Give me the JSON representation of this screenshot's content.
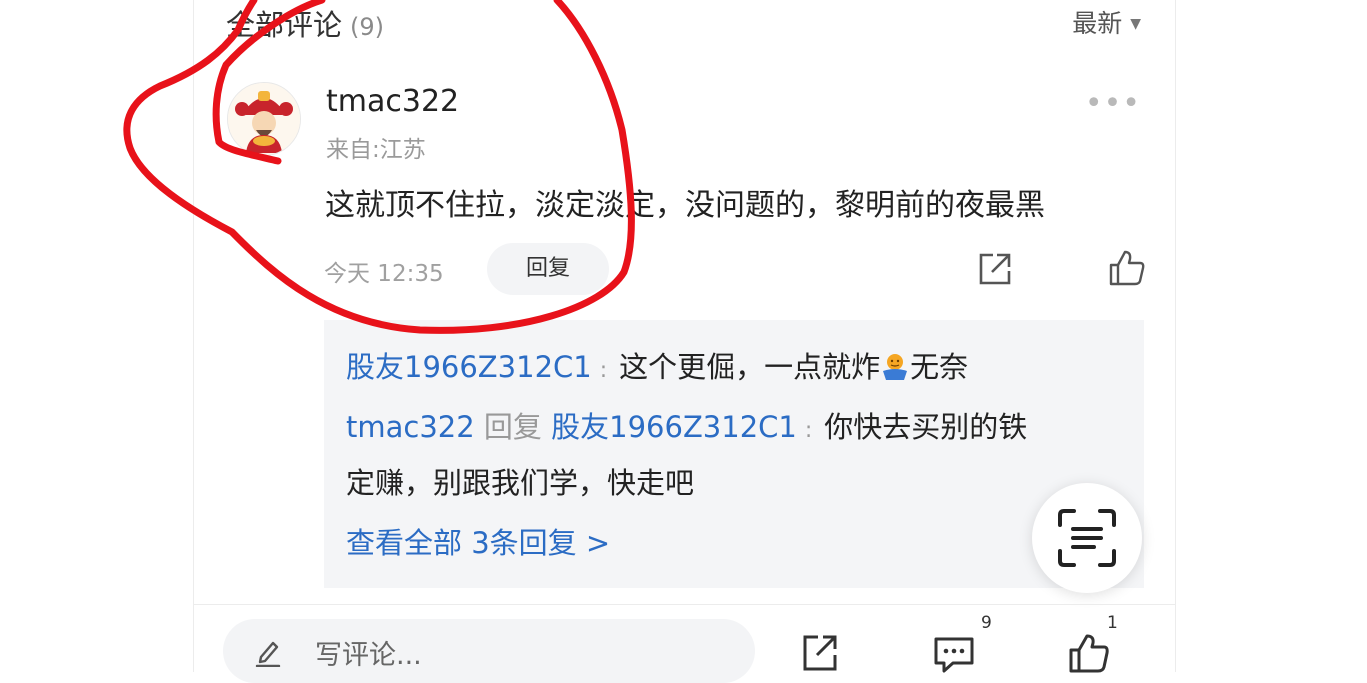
{
  "header": {
    "title": "全部评论",
    "count": "(9)",
    "sort_label": "最新"
  },
  "comment": {
    "username": "tmac322",
    "location": "来自:江苏",
    "text": "这就顶不住拉，淡定淡定，没问题的，黎明前的夜最黑",
    "time": "今天 12:35",
    "reply_label": "回复"
  },
  "replies": {
    "r1_user": "股友1966Z312C1",
    "r1_colon": ":",
    "r1_text_a": "这个更倔，一点就炸",
    "r1_text_b": "无奈",
    "r2_user": "tmac322",
    "r2_reply_word": "回复",
    "r2_target": "股友1966Z312C1",
    "r2_colon": ":",
    "r2_text_line1": "你快去买别的铁",
    "r2_text_line2": "定赚，别跟我们学，快走吧",
    "view_all": "查看全部 3条回复 >"
  },
  "bottom_bar": {
    "placeholder": "写评论...",
    "comment_count": "9",
    "like_count": "1"
  },
  "icons": {
    "more": "more-icon",
    "share": "share-icon",
    "like": "thumbs-up-icon",
    "scan": "scan-text-icon",
    "pencil": "pencil-icon",
    "comment": "comment-icon"
  },
  "colors": {
    "link_blue": "#2b6cc4",
    "annotation_red": "#e8121a"
  }
}
